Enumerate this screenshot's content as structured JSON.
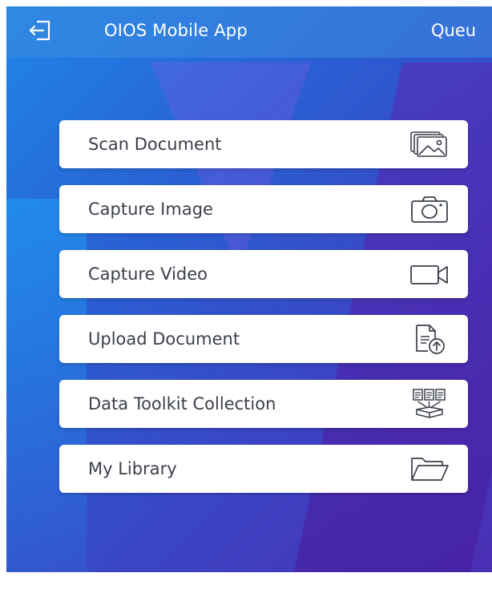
{
  "header": {
    "logout_icon": "logout-icon",
    "title": "OIOS Mobile App",
    "queue_label": "Queu"
  },
  "menu": {
    "items": [
      {
        "label": "Scan Document",
        "icon": "scan-document-icon"
      },
      {
        "label": "Capture Image",
        "icon": "camera-icon"
      },
      {
        "label": "Capture Video",
        "icon": "video-camera-icon"
      },
      {
        "label": "Upload Document",
        "icon": "upload-document-icon"
      },
      {
        "label": "Data Toolkit Collection",
        "icon": "data-toolkit-icon"
      },
      {
        "label": "My Library",
        "icon": "folder-icon"
      }
    ]
  },
  "colors": {
    "gradient_start": "#1f86e6",
    "gradient_end": "#4a2fb3",
    "card_background": "#ffffff",
    "card_text": "#3a3f4a",
    "icon_stroke": "#3a3f4a"
  }
}
